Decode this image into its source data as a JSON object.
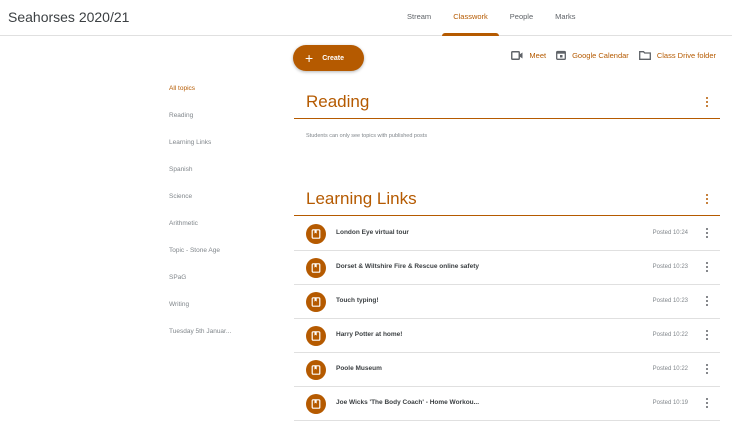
{
  "header": {
    "class_title": "Seahorses 2020/21",
    "tabs": [
      "Stream",
      "Classwork",
      "People",
      "Marks"
    ],
    "active_tab": "Classwork"
  },
  "toolbar": {
    "create_label": "Create",
    "meet_label": "Meet",
    "calendar_label": "Google Calendar",
    "drive_label": "Class Drive folder"
  },
  "sidebar": {
    "topics": [
      "All topics",
      "Reading",
      "Learning Links",
      "Spanish",
      "Science",
      "Arithmetic",
      "Topic - Stone Age",
      "SPaG",
      "Writing",
      "Tuesday 5th Januar..."
    ],
    "active": "All topics"
  },
  "sections": [
    {
      "title": "Reading",
      "note": "Students can only see topics with published posts"
    },
    {
      "title": "Learning Links",
      "items": [
        {
          "title": "London Eye virtual tour",
          "posted": "Posted 10:24"
        },
        {
          "title": "Dorset & Wiltshire Fire & Rescue online safety",
          "posted": "Posted 10:23"
        },
        {
          "title": "Touch typing!",
          "posted": "Posted 10:23"
        },
        {
          "title": "Harry Potter at home!",
          "posted": "Posted 10:22"
        },
        {
          "title": "Poole Museum",
          "posted": "Posted 10:22"
        },
        {
          "title": "Joe Wicks 'The Body Coach' - Home Workou...",
          "posted": "Posted 10:19"
        }
      ]
    }
  ],
  "colors": {
    "accent": "#b55a00",
    "text": "#3c4043",
    "muted": "#80868b",
    "divider": "#e0e0e0"
  }
}
